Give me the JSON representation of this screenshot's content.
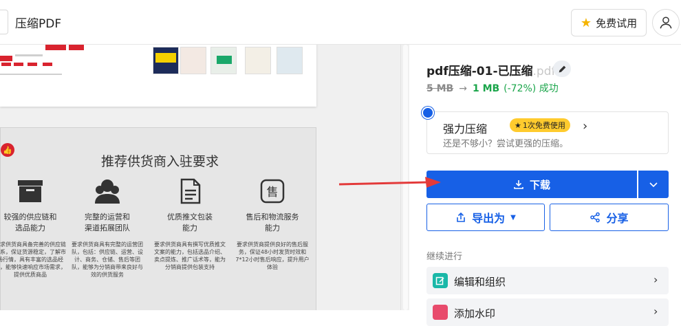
{
  "header": {
    "title": "压缩PDF",
    "trial_label": "免费试用"
  },
  "preview": {
    "page2_heading": "推荐供货商入驻要求",
    "columns": [
      {
        "caption": "较强的供应链和\n选品能力",
        "desc": "要求供货商具备完善的供应链体系，保证货源稳定，了解市场行情，具有丰富的选品经验，能够快速响应市场需求，提供优质商品"
      },
      {
        "caption": "完整的运营和\n渠道拓展团队",
        "desc": "要求供货商具有完整的运营团队，包括：供应链、运营、设计、商务、仓储、售后等团队，能够为分销商带来良好与效的供货服务"
      },
      {
        "caption": "优质推文包装\n能力",
        "desc": "要求供货商具有撰写优质推文文案的能力，包括选品介绍、卖点提炼、推广话术等，能为分销商提供包装支持"
      },
      {
        "caption": "售后和物流服务\n能力",
        "desc": "要求供货商提供良好的售后服务，保证48小时发货时效和7*12小时售后响应，提升用户体验"
      }
    ]
  },
  "panel": {
    "file_name": "pdf压缩-01-已压缩",
    "file_ext": ".pdf",
    "old_size": "5 MB",
    "arrow": "→",
    "new_size": "1 MB",
    "reduction": "(-72%) 成功",
    "strong": {
      "title": "强力压缩",
      "badge": "1次免费使用",
      "subtitle": "还是不够小？尝试更强的压缩。"
    },
    "download_label": "下载",
    "export_label": "导出为",
    "share_label": "分享",
    "continue_label": "继续进行",
    "continue_items": [
      {
        "label": "编辑和组织",
        "icon": "edit-organize-icon",
        "color": "#1ab8a8"
      },
      {
        "label": "添加水印",
        "icon": "watermark-icon",
        "color": "#e84b6c"
      }
    ]
  },
  "colors": {
    "accent": "#1760e6",
    "success": "#1aa54a",
    "badge": "#ffcb2e",
    "brand_red": "#d9232e"
  }
}
